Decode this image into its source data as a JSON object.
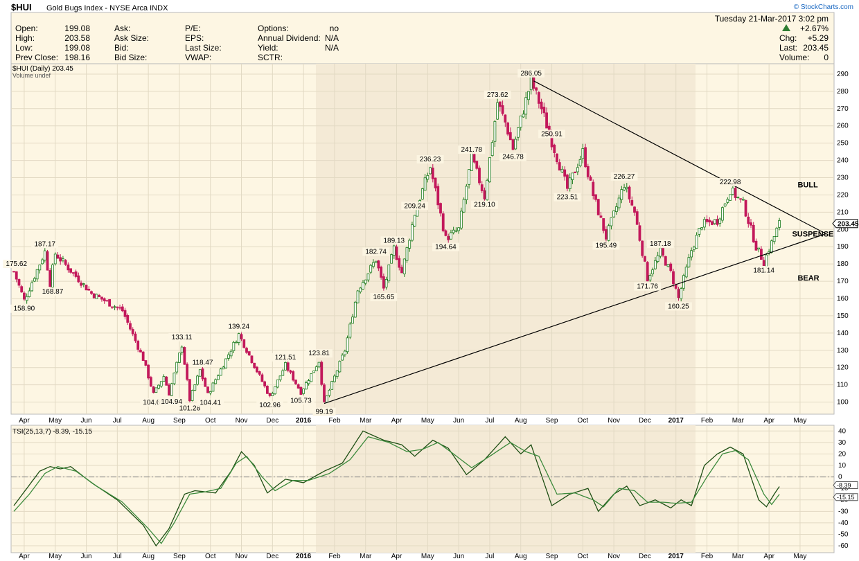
{
  "header": {
    "symbol": "$HUI",
    "name": "Gold Bugs Index - NYSE Arca INDX",
    "credit": "© StockCharts.com",
    "datetime": "Tuesday  21-Mar-2017  3:02 pm",
    "change_pct": "+2.67%",
    "chg_label": "Chg:",
    "chg_value": "+5.29",
    "last_label": "Last:",
    "last_value": "203.45",
    "volume_label": "Volume:",
    "volume_value": "0",
    "up_arrow_icon": "up-triangle-icon"
  },
  "stats": {
    "col1": [
      {
        "label": "Open:",
        "value": "199.08"
      },
      {
        "label": "High:",
        "value": "203.58"
      },
      {
        "label": "Low:",
        "value": "199.08"
      },
      {
        "label": "Prev Close:",
        "value": "198.16"
      }
    ],
    "col2": [
      {
        "label": "Ask:",
        "value": ""
      },
      {
        "label": "Ask Size:",
        "value": ""
      },
      {
        "label": "Bid:",
        "value": ""
      },
      {
        "label": "Bid Size:",
        "value": ""
      }
    ],
    "col3": [
      {
        "label": "P/E:",
        "value": ""
      },
      {
        "label": "EPS:",
        "value": ""
      },
      {
        "label": "Last Size:",
        "value": ""
      },
      {
        "label": "VWAP:",
        "value": ""
      }
    ],
    "col4": [
      {
        "label": "Options:",
        "value": "no"
      },
      {
        "label": "Annual Dividend:",
        "value": "N/A"
      },
      {
        "label": "Yield:",
        "value": "N/A"
      },
      {
        "label": "SCTR:",
        "value": ""
      }
    ]
  },
  "chart_data": [
    {
      "type": "candlestick",
      "legend": "$HUI (Daily) 203.45",
      "legend2": "Volume undef",
      "last_tag": "203.45",
      "ylim": [
        93,
        296
      ],
      "ticks": [
        100,
        110,
        120,
        130,
        140,
        150,
        160,
        170,
        180,
        190,
        200,
        210,
        220,
        230,
        240,
        250,
        260,
        270,
        280,
        290
      ],
      "x_labels": [
        "Apr",
        "May",
        "Jun",
        "Jul",
        "Aug",
        "Sep",
        "Oct",
        "Nov",
        "Dec",
        "2016",
        "Feb",
        "Mar",
        "Apr",
        "May",
        "Jun",
        "Jul",
        "Aug",
        "Sep",
        "Oct",
        "Nov",
        "Dec",
        "2017",
        "Feb",
        "Mar",
        "Apr",
        "May"
      ],
      "bold_labels": [
        "2016",
        "2017"
      ],
      "key_points": [
        {
          "t": 0,
          "v": 175.62
        },
        {
          "t": 4,
          "v": 158.9
        },
        {
          "t": 12,
          "v": 187.17
        },
        {
          "t": 14,
          "v": 168.87
        },
        {
          "t": 16,
          "v": 186.0
        },
        {
          "t": 30,
          "v": 163.0
        },
        {
          "t": 42,
          "v": 153.0
        },
        {
          "t": 50,
          "v": 125.0
        },
        {
          "t": 54,
          "v": 104.66
        },
        {
          "t": 58,
          "v": 115.0
        },
        {
          "t": 60,
          "v": 104.94
        },
        {
          "t": 65,
          "v": 133.11
        },
        {
          "t": 68,
          "v": 101.28
        },
        {
          "t": 72,
          "v": 118.47
        },
        {
          "t": 75,
          "v": 104.41
        },
        {
          "t": 87,
          "v": 139.24
        },
        {
          "t": 95,
          "v": 115.0
        },
        {
          "t": 99,
          "v": 102.96
        },
        {
          "t": 105,
          "v": 121.51
        },
        {
          "t": 111,
          "v": 105.73
        },
        {
          "t": 118,
          "v": 123.81
        },
        {
          "t": 120,
          "v": 99.19
        },
        {
          "t": 128,
          "v": 130.0
        },
        {
          "t": 133,
          "v": 165.0
        },
        {
          "t": 140,
          "v": 182.74
        },
        {
          "t": 143,
          "v": 165.65
        },
        {
          "t": 147,
          "v": 189.13
        },
        {
          "t": 150,
          "v": 175.0
        },
        {
          "t": 155,
          "v": 209.24
        },
        {
          "t": 161,
          "v": 236.23
        },
        {
          "t": 167,
          "v": 194.64
        },
        {
          "t": 172,
          "v": 200.0
        },
        {
          "t": 177,
          "v": 241.78
        },
        {
          "t": 182,
          "v": 219.1
        },
        {
          "t": 187,
          "v": 273.62
        },
        {
          "t": 190,
          "v": 262.0
        },
        {
          "t": 193,
          "v": 246.78
        },
        {
          "t": 200,
          "v": 286.05
        },
        {
          "t": 204,
          "v": 270.0
        },
        {
          "t": 208,
          "v": 250.91
        },
        {
          "t": 214,
          "v": 223.51
        },
        {
          "t": 220,
          "v": 245.0
        },
        {
          "t": 224,
          "v": 220.0
        },
        {
          "t": 229,
          "v": 195.49
        },
        {
          "t": 236,
          "v": 226.27
        },
        {
          "t": 240,
          "v": 210.0
        },
        {
          "t": 245,
          "v": 171.76
        },
        {
          "t": 250,
          "v": 187.18
        },
        {
          "t": 254,
          "v": 175.0
        },
        {
          "t": 257,
          "v": 160.25
        },
        {
          "t": 262,
          "v": 188.0
        },
        {
          "t": 266,
          "v": 203.0
        },
        {
          "t": 272,
          "v": 205.0
        },
        {
          "t": 277,
          "v": 222.98
        },
        {
          "t": 282,
          "v": 215.0
        },
        {
          "t": 287,
          "v": 190.0
        },
        {
          "t": 290,
          "v": 181.14
        },
        {
          "t": 296,
          "v": 203.45
        }
      ],
      "labels": [
        {
          "text": "175.62",
          "t": 1,
          "v": 175.62,
          "pos": "above"
        },
        {
          "text": "158.90",
          "t": 4,
          "v": 158.9,
          "pos": "below"
        },
        {
          "text": "187.17",
          "t": 12,
          "v": 187.17,
          "pos": "above"
        },
        {
          "text": "168.87",
          "t": 15,
          "v": 168.87,
          "pos": "below"
        },
        {
          "text": "104.66",
          "t": 54,
          "v": 104.66,
          "pos": "below"
        },
        {
          "text": "133.11",
          "t": 65,
          "v": 133.11,
          "pos": "above"
        },
        {
          "text": "104.94",
          "t": 61,
          "v": 104.94,
          "pos": "below"
        },
        {
          "text": "101.28",
          "t": 68,
          "v": 101.28,
          "pos": "below"
        },
        {
          "text": "118.47",
          "t": 73,
          "v": 118.47,
          "pos": "above"
        },
        {
          "text": "104.41",
          "t": 76,
          "v": 104.41,
          "pos": "below"
        },
        {
          "text": "139.24",
          "t": 87,
          "v": 139.24,
          "pos": "above"
        },
        {
          "text": "102.96",
          "t": 99,
          "v": 102.96,
          "pos": "below"
        },
        {
          "text": "121.51",
          "t": 105,
          "v": 121.51,
          "pos": "above"
        },
        {
          "text": "105.73",
          "t": 111,
          "v": 105.73,
          "pos": "below"
        },
        {
          "text": "123.81",
          "t": 118,
          "v": 123.81,
          "pos": "above"
        },
        {
          "text": "99.19",
          "t": 120,
          "v": 99.19,
          "pos": "below"
        },
        {
          "text": "182.74",
          "t": 140,
          "v": 182.74,
          "pos": "above"
        },
        {
          "text": "165.65",
          "t": 143,
          "v": 165.65,
          "pos": "below"
        },
        {
          "text": "189.13",
          "t": 147,
          "v": 189.13,
          "pos": "above"
        },
        {
          "text": "209.24",
          "t": 155,
          "v": 209.24,
          "pos": "above"
        },
        {
          "text": "236.23",
          "t": 161,
          "v": 236.23,
          "pos": "above"
        },
        {
          "text": "194.64",
          "t": 167,
          "v": 194.64,
          "pos": "below"
        },
        {
          "text": "241.78",
          "t": 177,
          "v": 241.78,
          "pos": "above"
        },
        {
          "text": "219.10",
          "t": 182,
          "v": 219.1,
          "pos": "below"
        },
        {
          "text": "273.62",
          "t": 187,
          "v": 273.62,
          "pos": "above"
        },
        {
          "text": "246.78",
          "t": 193,
          "v": 246.78,
          "pos": "below"
        },
        {
          "text": "286.05",
          "t": 200,
          "v": 286.05,
          "pos": "above"
        },
        {
          "text": "250.91",
          "t": 208,
          "v": 250.91,
          "pos": "above"
        },
        {
          "text": "223.51",
          "t": 214,
          "v": 223.51,
          "pos": "below"
        },
        {
          "text": "226.27",
          "t": 236,
          "v": 226.27,
          "pos": "above"
        },
        {
          "text": "195.49",
          "t": 229,
          "v": 195.49,
          "pos": "below"
        },
        {
          "text": "187.18",
          "t": 250,
          "v": 187.18,
          "pos": "above"
        },
        {
          "text": "171.76",
          "t": 245,
          "v": 171.76,
          "pos": "below"
        },
        {
          "text": "160.25",
          "t": 257,
          "v": 160.25,
          "pos": "below"
        },
        {
          "text": "222.98",
          "t": 277,
          "v": 222.98,
          "pos": "above"
        },
        {
          "text": "181.14",
          "t": 290,
          "v": 181.14,
          "pos": "below"
        }
      ],
      "trendlines": [
        {
          "from": {
            "t": 120,
            "v": 99.19
          },
          "to": {
            "t": 314,
            "v": 197.5
          }
        },
        {
          "from": {
            "t": 201,
            "v": 286.05
          },
          "to": {
            "t": 314,
            "v": 197.5
          }
        }
      ],
      "annotations": [
        {
          "text": "BULL",
          "t": 302,
          "v": 226
        },
        {
          "text": "SUSPENSE",
          "t": 302,
          "v": 197.5
        },
        {
          "text": "BEAR",
          "t": 302,
          "v": 172
        }
      ]
    },
    {
      "type": "line",
      "legend": "TSI(25,13,7) -8.39, -15.15",
      "ylim": [
        -66,
        45
      ],
      "ticks": [
        40,
        30,
        20,
        10,
        0,
        -10,
        -20,
        -30,
        -40,
        -50,
        -60
      ],
      "zero_line": 0,
      "last_tags": [
        "-8.39",
        "-15.15"
      ],
      "series": [
        {
          "key_points": [
            {
              "t": 0,
              "v": -25
            },
            {
              "t": 5,
              "v": -10
            },
            {
              "t": 10,
              "v": 5
            },
            {
              "t": 14,
              "v": 9
            },
            {
              "t": 18,
              "v": 7
            },
            {
              "t": 22,
              "v": 9
            },
            {
              "t": 30,
              "v": -5
            },
            {
              "t": 40,
              "v": -20
            },
            {
              "t": 50,
              "v": -42
            },
            {
              "t": 55,
              "v": -60
            },
            {
              "t": 60,
              "v": -45
            },
            {
              "t": 66,
              "v": -15
            },
            {
              "t": 70,
              "v": -12
            },
            {
              "t": 78,
              "v": -14
            },
            {
              "t": 84,
              "v": 5
            },
            {
              "t": 88,
              "v": 22
            },
            {
              "t": 93,
              "v": 10
            },
            {
              "t": 98,
              "v": -14
            },
            {
              "t": 105,
              "v": -2
            },
            {
              "t": 112,
              "v": -5
            },
            {
              "t": 120,
              "v": 5
            },
            {
              "t": 127,
              "v": 12
            },
            {
              "t": 135,
              "v": 40
            },
            {
              "t": 143,
              "v": 32
            },
            {
              "t": 150,
              "v": 28
            },
            {
              "t": 155,
              "v": 18
            },
            {
              "t": 162,
              "v": 32
            },
            {
              "t": 168,
              "v": 25
            },
            {
              "t": 175,
              "v": 2
            },
            {
              "t": 182,
              "v": 15
            },
            {
              "t": 190,
              "v": 35
            },
            {
              "t": 196,
              "v": 20
            },
            {
              "t": 200,
              "v": 28
            },
            {
              "t": 208,
              "v": -25
            },
            {
              "t": 215,
              "v": -15
            },
            {
              "t": 222,
              "v": -10
            },
            {
              "t": 226,
              "v": -30
            },
            {
              "t": 232,
              "v": -15
            },
            {
              "t": 237,
              "v": -8
            },
            {
              "t": 242,
              "v": -25
            },
            {
              "t": 248,
              "v": -20
            },
            {
              "t": 254,
              "v": -27
            },
            {
              "t": 258,
              "v": -20
            },
            {
              "t": 262,
              "v": -25
            },
            {
              "t": 267,
              "v": 10
            },
            {
              "t": 272,
              "v": 20
            },
            {
              "t": 277,
              "v": 26
            },
            {
              "t": 282,
              "v": 20
            },
            {
              "t": 288,
              "v": -20
            },
            {
              "t": 291,
              "v": -26
            },
            {
              "t": 294,
              "v": -15
            },
            {
              "t": 296,
              "v": -8.39
            }
          ]
        },
        {
          "key_points": [
            {
              "t": 0,
              "v": -30
            },
            {
              "t": 6,
              "v": -15
            },
            {
              "t": 12,
              "v": 3
            },
            {
              "t": 17,
              "v": 9
            },
            {
              "t": 24,
              "v": 5
            },
            {
              "t": 32,
              "v": -8
            },
            {
              "t": 42,
              "v": -22
            },
            {
              "t": 52,
              "v": -45
            },
            {
              "t": 57,
              "v": -58
            },
            {
              "t": 62,
              "v": -40
            },
            {
              "t": 68,
              "v": -15
            },
            {
              "t": 74,
              "v": -13
            },
            {
              "t": 80,
              "v": -10
            },
            {
              "t": 86,
              "v": 12
            },
            {
              "t": 90,
              "v": 18
            },
            {
              "t": 96,
              "v": 0
            },
            {
              "t": 101,
              "v": -12
            },
            {
              "t": 108,
              "v": -3
            },
            {
              "t": 114,
              "v": -3
            },
            {
              "t": 122,
              "v": 3
            },
            {
              "t": 130,
              "v": 15
            },
            {
              "t": 137,
              "v": 35
            },
            {
              "t": 145,
              "v": 30
            },
            {
              "t": 152,
              "v": 22
            },
            {
              "t": 158,
              "v": 24
            },
            {
              "t": 164,
              "v": 30
            },
            {
              "t": 170,
              "v": 20
            },
            {
              "t": 177,
              "v": 8
            },
            {
              "t": 184,
              "v": 18
            },
            {
              "t": 192,
              "v": 30
            },
            {
              "t": 198,
              "v": 22
            },
            {
              "t": 203,
              "v": 18
            },
            {
              "t": 210,
              "v": -15
            },
            {
              "t": 217,
              "v": -14
            },
            {
              "t": 224,
              "v": -20
            },
            {
              "t": 228,
              "v": -26
            },
            {
              "t": 234,
              "v": -10
            },
            {
              "t": 240,
              "v": -12
            },
            {
              "t": 245,
              "v": -22
            },
            {
              "t": 251,
              "v": -22
            },
            {
              "t": 256,
              "v": -23
            },
            {
              "t": 262,
              "v": -22
            },
            {
              "t": 268,
              "v": 0
            },
            {
              "t": 274,
              "v": 20
            },
            {
              "t": 279,
              "v": 23
            },
            {
              "t": 284,
              "v": 15
            },
            {
              "t": 290,
              "v": -15
            },
            {
              "t": 293,
              "v": -24
            },
            {
              "t": 296,
              "v": -15.15
            }
          ]
        }
      ]
    }
  ]
}
